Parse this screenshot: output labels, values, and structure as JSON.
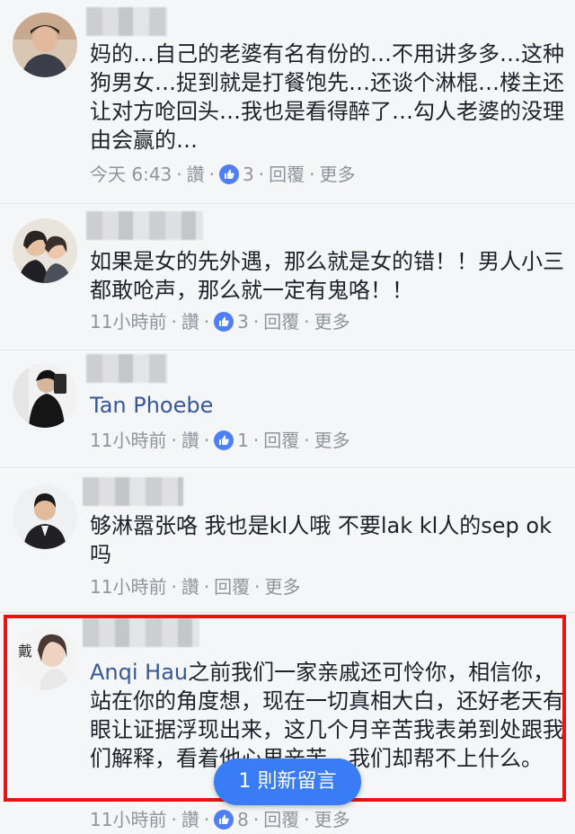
{
  "comments": [
    {
      "author": "",
      "text": "妈的…自己的老婆有名有份的…不用讲多多…这种狗男女…捉到就是打餐饱先…还谈个淋棍…楼主还让对方呛回头…我也是看得醉了…勾人老婆的没理由会赢的…",
      "time": "今天 6:43",
      "like_label": "讚",
      "reaction_count": "3",
      "reply_label": "回覆",
      "more_label": "更多",
      "separator": "·"
    },
    {
      "author": "",
      "text": "如果是女的先外遇，那么就是女的错！！男人小三都敢呛声，那么就一定有鬼咯！！",
      "time": "11小時前",
      "like_label": "讚",
      "reaction_count": "3",
      "reply_label": "回覆",
      "more_label": "更多",
      "separator": "·"
    },
    {
      "author": "",
      "text": "Tan Phoebe",
      "time": "11小時前",
      "like_label": "讚",
      "reaction_count": "1",
      "reply_label": "回覆",
      "more_label": "更多",
      "separator": "·"
    },
    {
      "author": "",
      "text": "够淋嚣张咯 我也是kl人哦 不要lak kl人的sep ok吗",
      "time": "11小時前",
      "like_label": "讚",
      "reaction_count": "",
      "reply_label": "回覆",
      "more_label": "更多",
      "separator": "·"
    },
    {
      "author": "",
      "mention": "Anqi Hau",
      "text": "之前我们一家亲戚还可怜你，相信你，站在你的角度想，现在一切真相大白，还好老天有眼让证据浮现出来，这几个月辛苦我表弟到处跟我们解释，看着他心里辛苦，我们却帮不上什么。",
      "time": "11小時前",
      "like_label": "讚",
      "reaction_count": "8",
      "reply_label": "回覆",
      "more_label": "更多",
      "separator": "·"
    }
  ],
  "new_comment_pill": "1 則新留言",
  "colors": {
    "background": "#f5f6f7",
    "link_blue": "#365899",
    "meta_gray": "#90949c",
    "like_blue": "#4f7ff7",
    "highlight_red": "#e61414",
    "pill_blue": "#3a7bf6"
  },
  "icons": {
    "like": "thumbs-up-icon"
  }
}
